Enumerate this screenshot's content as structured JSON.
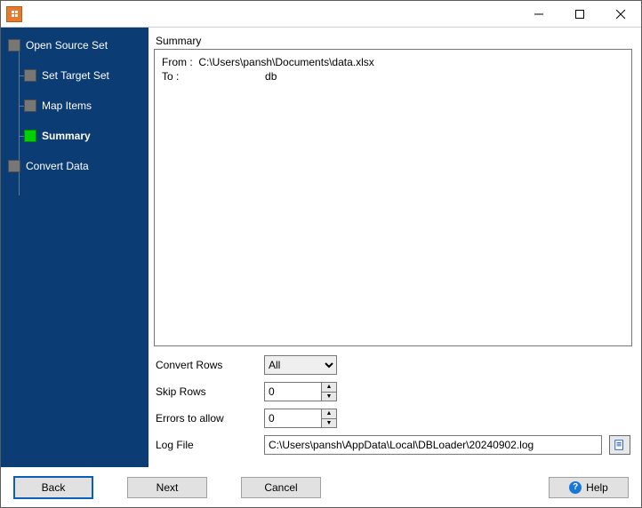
{
  "window": {
    "title": ""
  },
  "sidebar": {
    "items": [
      {
        "label": "Open Source Set",
        "active": false
      },
      {
        "label": "Set Target Set",
        "active": false
      },
      {
        "label": "Map Items",
        "active": false
      },
      {
        "label": "Summary",
        "active": true
      },
      {
        "label": "Convert Data",
        "active": false
      }
    ]
  },
  "summary": {
    "header": "Summary",
    "from_label": "From :",
    "from_value": "C:\\Users\\pansh\\Documents\\data.xlsx",
    "to_label": "To :",
    "to_value": "db"
  },
  "form": {
    "convert_rows": {
      "label": "Convert Rows",
      "value": "All",
      "options": [
        "All"
      ]
    },
    "skip_rows": {
      "label": "Skip Rows",
      "value": "0"
    },
    "errors_to_allow": {
      "label": "Errors to allow",
      "value": "0"
    },
    "log_file": {
      "label": "Log File",
      "value": "C:\\Users\\pansh\\AppData\\Local\\DBLoader\\20240902.log"
    }
  },
  "buttons": {
    "back": "Back",
    "next": "Next",
    "cancel": "Cancel",
    "help": "Help"
  }
}
